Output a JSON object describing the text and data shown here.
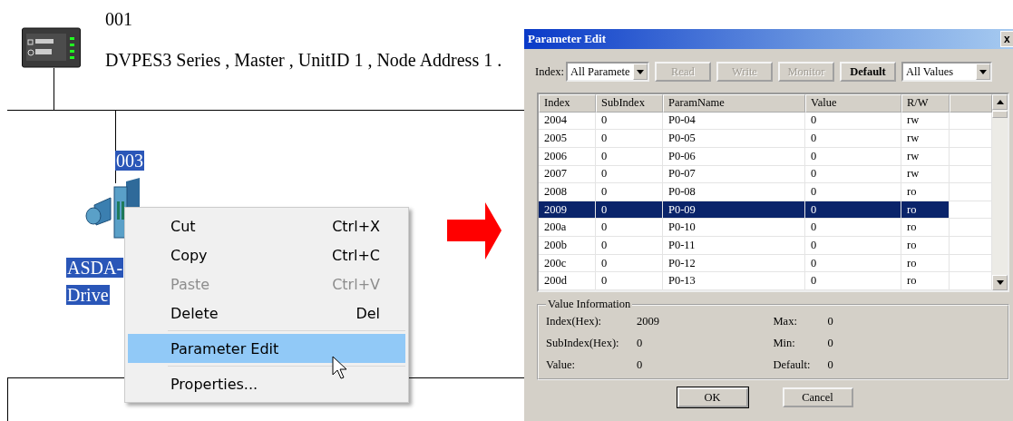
{
  "diagram": {
    "master": {
      "node": "001",
      "description": "DVPES3 Series , Master , UnitID 1 , Node Address 1 ."
    },
    "slave": {
      "node": "003",
      "name_lines": [
        "ASDA-",
        "Drive"
      ],
      "selected": true
    }
  },
  "context_menu": {
    "items": [
      {
        "kind": "item",
        "label": "Cut",
        "shortcut": "Ctrl+X",
        "disabled": false,
        "selected": false
      },
      {
        "kind": "item",
        "label": "Copy",
        "shortcut": "Ctrl+C",
        "disabled": false,
        "selected": false
      },
      {
        "kind": "item",
        "label": "Paste",
        "shortcut": "Ctrl+V",
        "disabled": true,
        "selected": false
      },
      {
        "kind": "item",
        "label": "Delete",
        "shortcut": "Del",
        "disabled": false,
        "selected": false
      },
      {
        "kind": "separator"
      },
      {
        "kind": "item",
        "label": "Parameter Edit",
        "disabled": false,
        "selected": true
      },
      {
        "kind": "separator"
      },
      {
        "kind": "item",
        "label": "Properties...",
        "disabled": false,
        "selected": false
      }
    ]
  },
  "dialog": {
    "title": "Parameter Edit",
    "close": "x",
    "index_label": "Index:",
    "index_select": "All Paramete",
    "buttons": [
      {
        "label": "Read",
        "disabled": true
      },
      {
        "label": "Write",
        "disabled": true
      },
      {
        "label": "Monitor",
        "disabled": true
      },
      {
        "label": "Default",
        "disabled": false
      }
    ],
    "filter_select": "All Values",
    "table": {
      "columns": [
        "Index",
        "SubIndex",
        "ParamName",
        "Value",
        "R/W"
      ],
      "rows": [
        {
          "cells": [
            "2004",
            "0",
            "P0-04",
            "0",
            "rw"
          ],
          "selected": false
        },
        {
          "cells": [
            "2005",
            "0",
            "P0-05",
            "0",
            "rw"
          ],
          "selected": false
        },
        {
          "cells": [
            "2006",
            "0",
            "P0-06",
            "0",
            "rw"
          ],
          "selected": false
        },
        {
          "cells": [
            "2007",
            "0",
            "P0-07",
            "0",
            "rw"
          ],
          "selected": false
        },
        {
          "cells": [
            "2008",
            "0",
            "P0-08",
            "0",
            "ro"
          ],
          "selected": false
        },
        {
          "cells": [
            "2009",
            "0",
            "P0-09",
            "0",
            "ro"
          ],
          "selected": true
        },
        {
          "cells": [
            "200a",
            "0",
            "P0-10",
            "0",
            "ro"
          ],
          "selected": false
        },
        {
          "cells": [
            "200b",
            "0",
            "P0-11",
            "0",
            "ro"
          ],
          "selected": false
        },
        {
          "cells": [
            "200c",
            "0",
            "P0-12",
            "0",
            "ro"
          ],
          "selected": false
        },
        {
          "cells": [
            "200d",
            "0",
            "P0-13",
            "0",
            "ro"
          ],
          "selected": false
        }
      ]
    },
    "value_information": {
      "title": "Value Information",
      "left": [
        {
          "label": "Index(Hex):",
          "value": "2009"
        },
        {
          "label": "SubIndex(Hex):",
          "value": "0"
        },
        {
          "label": "Value:",
          "value": "0"
        }
      ],
      "right": [
        {
          "label": "Max:",
          "value": "0"
        },
        {
          "label": "Min:",
          "value": "0"
        },
        {
          "label": "Default:",
          "value": "0"
        }
      ]
    },
    "footer_buttons": [
      "OK",
      "Cancel"
    ]
  }
}
